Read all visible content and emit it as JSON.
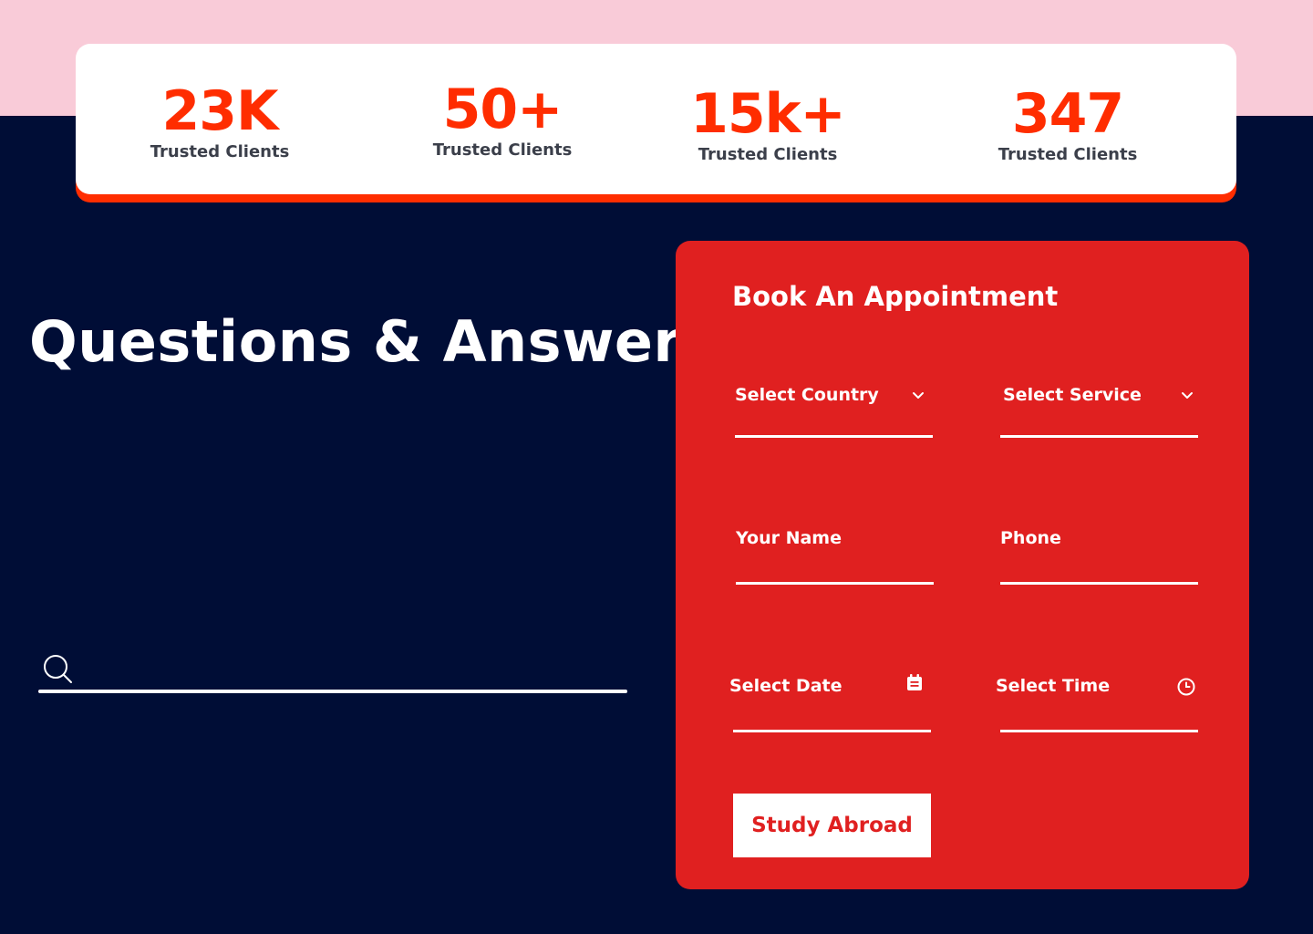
{
  "stats": [
    {
      "value": "23K",
      "label": "Trusted Clients"
    },
    {
      "value": "50+",
      "label": "Trusted Clients"
    },
    {
      "value": "15k+",
      "label": "Trusted Clients"
    },
    {
      "value": "347",
      "label": "Trusted Clients"
    }
  ],
  "qa": {
    "title": "Questions & Answers",
    "search": {
      "value": "",
      "placeholder": "",
      "icon": "search-icon"
    }
  },
  "appointment": {
    "title": "Book An Appointment",
    "fields": {
      "country": {
        "label": "Select Country",
        "icon": "chevron-down-icon"
      },
      "service": {
        "label": "Select Service",
        "icon": "chevron-down-icon"
      },
      "name": {
        "label": "Your Name"
      },
      "phone": {
        "label": "Phone"
      },
      "date": {
        "label": "Select Date",
        "icon": "calendar-icon"
      },
      "time": {
        "label": "Select Time",
        "icon": "clock-icon"
      }
    },
    "submit_label": "Study Abroad"
  },
  "colors": {
    "page_background": "#000d36",
    "top_band": "#f9cbd8",
    "accent_orange": "#ff2d00",
    "form_red": "#e02020",
    "white": "#ffffff"
  }
}
